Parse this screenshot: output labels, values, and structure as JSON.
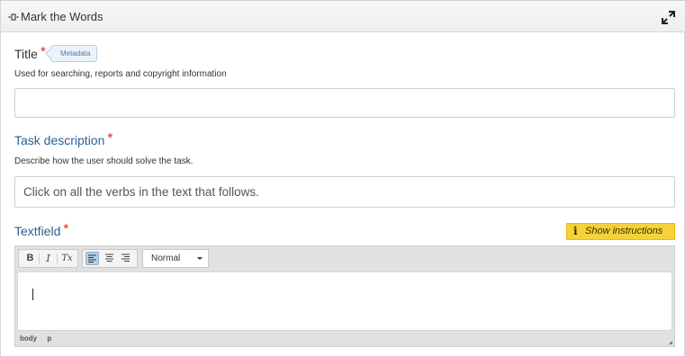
{
  "header": {
    "title": "Mark the Words",
    "icon": "widget-icon",
    "expand_icon": "expand-icon"
  },
  "title_field": {
    "label": "Title",
    "required_mark": "*",
    "metadata_badge": "Metadata",
    "description": "Used for searching, reports and copyright information",
    "value": "",
    "placeholder": ""
  },
  "task_description": {
    "label": "Task description",
    "required_mark": "*",
    "description": "Describe how the user should solve the task.",
    "value": "Click on all the verbs in the text that follows."
  },
  "textfield": {
    "label": "Textfield",
    "required_mark": "*",
    "show_instructions": "Show instructions",
    "info_icon": "info-icon",
    "toolbar": {
      "bold": "B",
      "italic": "I",
      "remove_format": "Tx",
      "format_selected": "Normal"
    },
    "editor_value": "",
    "path": [
      "body",
      "p"
    ]
  },
  "colors": {
    "label_blue": "#2b5f93",
    "required_red": "#e0241b",
    "instructions_yellow": "#f5d23a"
  }
}
